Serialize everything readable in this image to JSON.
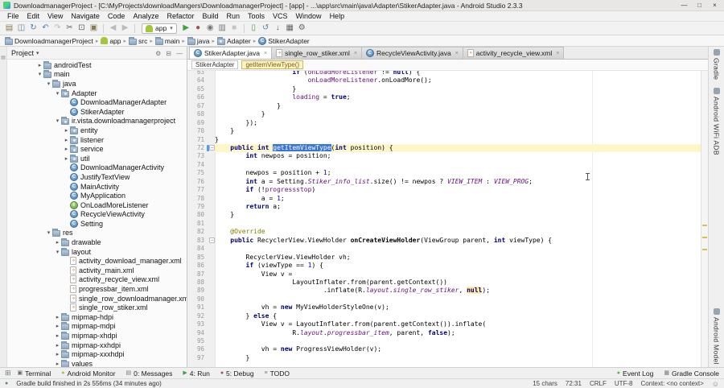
{
  "window": {
    "title": "DownloadmanagerProject - [C:\\MyProjects\\downloadMangers\\DownloadmanagerProject] - [app] - ...\\app\\src\\main\\java\\Adapter\\StikerAdapter.java - Android Studio 2.3.3",
    "controls": {
      "minimize": "—",
      "maximize": "□",
      "close": "×"
    }
  },
  "menu_bar": [
    "File",
    "Edit",
    "View",
    "Navigate",
    "Code",
    "Analyze",
    "Refactor",
    "Build",
    "Run",
    "Tools",
    "VCS",
    "Window",
    "Help"
  ],
  "toolbar": {
    "groups": [
      [
        {
          "name": "open",
          "glyph": "▤",
          "color": "#8a7a52"
        },
        {
          "name": "save-all",
          "glyph": "◫",
          "color": "#5f7f9f"
        },
        {
          "name": "synchronize",
          "glyph": "↻",
          "color": "#4e7fae"
        },
        {
          "name": "undo",
          "glyph": "↶",
          "color": "#4e7fae"
        },
        {
          "name": "redo",
          "glyph": "↷",
          "color": "#b9b9b9"
        },
        {
          "name": "cut",
          "glyph": "✂",
          "color": "#666666"
        },
        {
          "name": "copy",
          "glyph": "⊡",
          "color": "#666666"
        },
        {
          "name": "paste",
          "glyph": "▣",
          "color": "#8a7a52"
        }
      ],
      [
        {
          "name": "back",
          "glyph": "◀",
          "color": "#bbbbbb"
        },
        {
          "name": "forward",
          "glyph": "▶",
          "color": "#bbbbbb"
        }
      ],
      [
        {
          "name": "run-configuration",
          "type": "combo",
          "label": "app"
        },
        {
          "name": "run",
          "glyph": "▶",
          "color": "#3fa33f"
        },
        {
          "name": "debug",
          "glyph": "●",
          "color": "#9d5353"
        },
        {
          "name": "run-with-coverage",
          "glyph": "◉",
          "color": "#777777"
        },
        {
          "name": "profile",
          "glyph": "▥",
          "color": "#777777"
        },
        {
          "name": "stop",
          "glyph": "■",
          "color": "#c4c4c4"
        }
      ],
      [
        {
          "name": "avd-manager",
          "glyph": "▯",
          "color": "#3fa33f"
        },
        {
          "name": "sync-project-with-gradle",
          "glyph": "↺",
          "color": "#5f7f9f"
        },
        {
          "name": "sdk-manager",
          "glyph": "↓",
          "color": "#666666"
        },
        {
          "name": "device-monitor",
          "glyph": "▦",
          "color": "#666666"
        },
        {
          "name": "settings",
          "glyph": "⚙",
          "color": "#666666"
        }
      ]
    ]
  },
  "navbar": {
    "separator": "▸",
    "crumbs": [
      {
        "label": "DownloadmanagerProject",
        "icon": "folder"
      },
      {
        "label": "app",
        "icon": "android"
      },
      {
        "label": "src",
        "icon": "folder"
      },
      {
        "label": "main",
        "icon": "folder"
      },
      {
        "label": "java",
        "icon": "folder"
      },
      {
        "label": "Adapter",
        "icon": "package"
      },
      {
        "label": "StikerAdapter",
        "icon": "class"
      }
    ]
  },
  "left_stripe_icon": "▤",
  "project_panel": {
    "title": "Project",
    "caret": "▾",
    "header_icons": [
      {
        "name": "settings-gear",
        "glyph": "⚙"
      },
      {
        "name": "collapse-all",
        "glyph": "⊟"
      },
      {
        "name": "hide-panel",
        "glyph": "—"
      }
    ],
    "tree": [
      {
        "d": 2,
        "a": "c",
        "t": "folder",
        "l": "androidTest"
      },
      {
        "d": 2,
        "a": "v",
        "t": "folder",
        "l": "main"
      },
      {
        "d": 3,
        "a": "v",
        "t": "folder",
        "l": "java"
      },
      {
        "d": 4,
        "a": "v",
        "t": "package",
        "l": "Adapter"
      },
      {
        "d": 5,
        "a": "",
        "t": "class",
        "l": "DownloadManagerAdapter"
      },
      {
        "d": 5,
        "a": "",
        "t": "class",
        "l": "StikerAdapter"
      },
      {
        "d": 4,
        "a": "v",
        "t": "package",
        "l": "ir.vista.downloadmanagerproject"
      },
      {
        "d": 5,
        "a": "c",
        "t": "package",
        "l": "entity"
      },
      {
        "d": 5,
        "a": "c",
        "t": "package",
        "l": "listener"
      },
      {
        "d": 5,
        "a": "c",
        "t": "package",
        "l": "service"
      },
      {
        "d": 5,
        "a": "c",
        "t": "package",
        "l": "util"
      },
      {
        "d": 5,
        "a": "",
        "t": "class",
        "l": "DownloadManagerActivity"
      },
      {
        "d": 5,
        "a": "",
        "t": "class",
        "l": "JustifyTextView"
      },
      {
        "d": 5,
        "a": "",
        "t": "class",
        "l": "MainActivity"
      },
      {
        "d": 5,
        "a": "",
        "t": "class",
        "l": "MyApplication"
      },
      {
        "d": 5,
        "a": "",
        "t": "interface",
        "l": "OnLoadMoreListener"
      },
      {
        "d": 5,
        "a": "",
        "t": "class",
        "l": "RecycleViewActivity"
      },
      {
        "d": 5,
        "a": "",
        "t": "class",
        "l": "Setting"
      },
      {
        "d": 3,
        "a": "v",
        "t": "folder",
        "l": "res"
      },
      {
        "d": 4,
        "a": "c",
        "t": "folder",
        "l": "drawable"
      },
      {
        "d": 4,
        "a": "v",
        "t": "folder",
        "l": "layout"
      },
      {
        "d": 5,
        "a": "",
        "t": "xml",
        "l": "activity_download_manager.xml"
      },
      {
        "d": 5,
        "a": "",
        "t": "xml",
        "l": "activity_main.xml"
      },
      {
        "d": 5,
        "a": "",
        "t": "xml",
        "l": "activity_recycle_view.xml"
      },
      {
        "d": 5,
        "a": "",
        "t": "xml",
        "l": "progressbar_item.xml"
      },
      {
        "d": 5,
        "a": "",
        "t": "xml",
        "l": "single_row_downloadmanager.xml"
      },
      {
        "d": 5,
        "a": "",
        "t": "xml",
        "l": "single_row_stiker.xml"
      },
      {
        "d": 4,
        "a": "c",
        "t": "folder",
        "l": "mipmap-hdpi"
      },
      {
        "d": 4,
        "a": "c",
        "t": "folder",
        "l": "mipmap-mdpi"
      },
      {
        "d": 4,
        "a": "c",
        "t": "folder",
        "l": "mipmap-xhdpi"
      },
      {
        "d": 4,
        "a": "c",
        "t": "folder",
        "l": "mipmap-xxhdpi"
      },
      {
        "d": 4,
        "a": "c",
        "t": "folder",
        "l": "mipmap-xxxhdpi"
      },
      {
        "d": 4,
        "a": "c",
        "t": "folder",
        "l": "values"
      }
    ]
  },
  "editor": {
    "tabs": [
      {
        "label": "StikerAdapter.java",
        "icon": "class",
        "active": true
      },
      {
        "label": "single_row_stiker.xml",
        "icon": "xml",
        "active": false
      },
      {
        "label": "RecycleViewActivity.java",
        "icon": "class",
        "active": false
      },
      {
        "label": "activity_recycle_view.xml",
        "icon": "xml",
        "active": false
      }
    ],
    "breadcrumbs": [
      {
        "label": "StikerAdapter",
        "current": false
      },
      {
        "label": "getItemViewType()",
        "current": true
      }
    ],
    "scrollbar_marks": [
      {
        "pos": 0.52,
        "color": "#d9c24a"
      },
      {
        "pos": 0.56,
        "color": "#d9c24a"
      },
      {
        "pos": 0.6,
        "color": "#d9c24a"
      }
    ],
    "code": {
      "lines": [
        {
          "n": 63,
          "s": [
            [
              "p",
              "                    "
            ],
            [
              "k",
              "if"
            ],
            [
              "p",
              " ("
            ],
            [
              "f",
              "onLoadMoreListener"
            ],
            [
              "p",
              " != "
            ],
            [
              "k",
              "null"
            ],
            [
              "p",
              ") {"
            ]
          ]
        },
        {
          "n": 64,
          "s": [
            [
              "p",
              "                        "
            ],
            [
              "f",
              "onLoadMoreListener"
            ],
            [
              "p",
              ".onLoadMore();"
            ]
          ]
        },
        {
          "n": 65,
          "s": [
            [
              "p",
              "                    }"
            ]
          ]
        },
        {
          "n": 66,
          "s": [
            [
              "p",
              "                    "
            ],
            [
              "f",
              "loading"
            ],
            [
              "p",
              " = "
            ],
            [
              "k",
              "true"
            ],
            [
              "p",
              ";"
            ]
          ]
        },
        {
          "n": 67,
          "s": [
            [
              "p",
              "                }"
            ]
          ]
        },
        {
          "n": 68,
          "s": [
            [
              "p",
              "            }"
            ]
          ]
        },
        {
          "n": 69,
          "s": [
            [
              "p",
              "        });"
            ]
          ]
        },
        {
          "n": 70,
          "s": [
            [
              "p",
              "    }"
            ]
          ]
        },
        {
          "n": 71,
          "s": [
            [
              "p",
              "}"
            ]
          ]
        },
        {
          "n": 72,
          "cur": true,
          "fold": true,
          "marker": true,
          "s": [
            [
              "p",
              "    "
            ],
            [
              "k",
              "public"
            ],
            [
              "p",
              " "
            ],
            [
              "k",
              "int"
            ],
            [
              "p",
              " "
            ],
            [
              "sel",
              "getItemViewType"
            ],
            [
              "p",
              "("
            ],
            [
              "k",
              "int"
            ],
            [
              "p",
              " position) {"
            ]
          ]
        },
        {
          "n": 73,
          "s": [
            [
              "p",
              "        "
            ],
            [
              "k",
              "int"
            ],
            [
              "p",
              " newpos = position;"
            ]
          ]
        },
        {
          "n": 74,
          "s": []
        },
        {
          "n": 75,
          "s": [
            [
              "p",
              "        newpos = position + "
            ],
            [
              "n",
              "1"
            ],
            [
              "p",
              ";"
            ]
          ]
        },
        {
          "n": 76,
          "s": [
            [
              "p",
              "        "
            ],
            [
              "k",
              "int"
            ],
            [
              "p",
              " a = Setting."
            ],
            [
              "sf",
              "Stiker_info_list"
            ],
            [
              "p",
              ".size() != newpos ? "
            ],
            [
              "sf",
              "VIEW_ITEM"
            ],
            [
              "p",
              " : "
            ],
            [
              "sf",
              "VIEW_PROG"
            ],
            [
              "p",
              ";"
            ]
          ]
        },
        {
          "n": 77,
          "s": [
            [
              "p",
              "        "
            ],
            [
              "k",
              "if"
            ],
            [
              "p",
              " (!"
            ],
            [
              "f",
              "progressstop"
            ],
            [
              "p",
              ")"
            ]
          ]
        },
        {
          "n": 78,
          "s": [
            [
              "p",
              "            a = "
            ],
            [
              "n",
              "1"
            ],
            [
              "p",
              ";"
            ]
          ]
        },
        {
          "n": 79,
          "s": [
            [
              "p",
              "        "
            ],
            [
              "k",
              "return"
            ],
            [
              "p",
              " a;"
            ]
          ]
        },
        {
          "n": 80,
          "s": [
            [
              "p",
              "    }"
            ]
          ]
        },
        {
          "n": 81,
          "s": []
        },
        {
          "n": 82,
          "s": [
            [
              "p",
              "    "
            ],
            [
              "a",
              "@Override"
            ]
          ]
        },
        {
          "n": 83,
          "fold": true,
          "s": [
            [
              "p",
              "    "
            ],
            [
              "k",
              "public"
            ],
            [
              "p",
              " RecyclerView.ViewHolder "
            ],
            [
              "b",
              "onCreateViewHolder"
            ],
            [
              "p",
              "(ViewGroup parent, "
            ],
            [
              "k",
              "int"
            ],
            [
              "p",
              " viewType) {"
            ]
          ]
        },
        {
          "n": 84,
          "s": []
        },
        {
          "n": 85,
          "s": [
            [
              "p",
              "        RecyclerView.ViewHolder vh;"
            ]
          ]
        },
        {
          "n": 86,
          "s": [
            [
              "p",
              "        "
            ],
            [
              "k",
              "if"
            ],
            [
              "p",
              " (viewType == "
            ],
            [
              "n",
              "1"
            ],
            [
              "p",
              ") {"
            ]
          ]
        },
        {
          "n": 87,
          "s": [
            [
              "p",
              "            View v ="
            ]
          ]
        },
        {
          "n": 88,
          "s": [
            [
              "p",
              "                    LayoutInflater.from(parent.getContext())"
            ]
          ]
        },
        {
          "n": 89,
          "s": [
            [
              "p",
              "                            .inflate(R."
            ],
            [
              "sf",
              "layout"
            ],
            [
              "p",
              "."
            ],
            [
              "sf",
              "single_row_stiker"
            ],
            [
              "p",
              ", "
            ],
            [
              "hl",
              "null"
            ],
            [
              "p",
              ");"
            ]
          ]
        },
        {
          "n": 90,
          "s": []
        },
        {
          "n": 91,
          "s": [
            [
              "p",
              "            vh = "
            ],
            [
              "k",
              "new"
            ],
            [
              "p",
              " MyViewHolderStyleOne(v);"
            ]
          ]
        },
        {
          "n": 92,
          "s": [
            [
              "p",
              "        } "
            ],
            [
              "k",
              "else"
            ],
            [
              "p",
              " {"
            ]
          ]
        },
        {
          "n": 93,
          "s": [
            [
              "p",
              "            View v = LayoutInflater.from(parent.getContext()).inflate("
            ]
          ]
        },
        {
          "n": 94,
          "s": [
            [
              "p",
              "                    R."
            ],
            [
              "sf",
              "layout"
            ],
            [
              "p",
              "."
            ],
            [
              "sf",
              "progressbar_item"
            ],
            [
              "p",
              ", parent, "
            ],
            [
              "k",
              "false"
            ],
            [
              "p",
              ");"
            ]
          ]
        },
        {
          "n": 95,
          "s": []
        },
        {
          "n": 96,
          "s": [
            [
              "p",
              "            vh = "
            ],
            [
              "k",
              "new"
            ],
            [
              "p",
              " ProgressViewHolder(v);"
            ]
          ]
        },
        {
          "n": 97,
          "s": [
            [
              "p",
              "        }"
            ]
          ]
        }
      ]
    }
  },
  "right_stripe": {
    "top": [
      {
        "label": "Gradle"
      },
      {
        "label": "Android WiFi ADB"
      }
    ],
    "bottom": [
      {
        "label": "Android Model"
      }
    ]
  },
  "bottom_bar": {
    "toggle_icon": "⊞",
    "left": [
      {
        "name": "terminal",
        "icon": "▣",
        "icon_color": "#666666",
        "label": "Terminal"
      },
      {
        "name": "android-monitor",
        "icon": "●",
        "icon_color": "#a4c639",
        "label": "Android Monitor"
      },
      {
        "name": "messages",
        "icon": "▤",
        "icon_color": "#777777",
        "label": "0: Messages"
      },
      {
        "name": "run",
        "icon": "▶",
        "icon_color": "#3fa33f",
        "label": "4: Run"
      },
      {
        "name": "debug",
        "icon": "●",
        "icon_color": "#9d5353",
        "label": "5: Debug"
      },
      {
        "name": "todo",
        "icon": "≡",
        "icon_color": "#777777",
        "label": "TODO"
      }
    ],
    "right": [
      {
        "name": "event-log",
        "icon": "●",
        "icon_color": "#62b543",
        "label": "Event Log"
      },
      {
        "name": "gradle-console",
        "icon": "▦",
        "icon_color": "#777777",
        "label": "Gradle Console"
      }
    ]
  },
  "status_bar": {
    "message_icon": "●",
    "message": "Gradle build finished in 2s 556ms (34 minutes ago)",
    "items": [
      "15 chars",
      "72:31",
      "CRLF",
      "UTF-8",
      "Context: <no context>"
    ],
    "inspector_icon": "☺"
  },
  "colors": {
    "selection": "#3875d7",
    "current_line": "#fcf6c8",
    "keyword": "#000080",
    "field": "#660e7a",
    "number": "#0000ff",
    "annotation": "#808000",
    "warning_highlight": "#ffe8a8",
    "android_green": "#a4c639"
  }
}
